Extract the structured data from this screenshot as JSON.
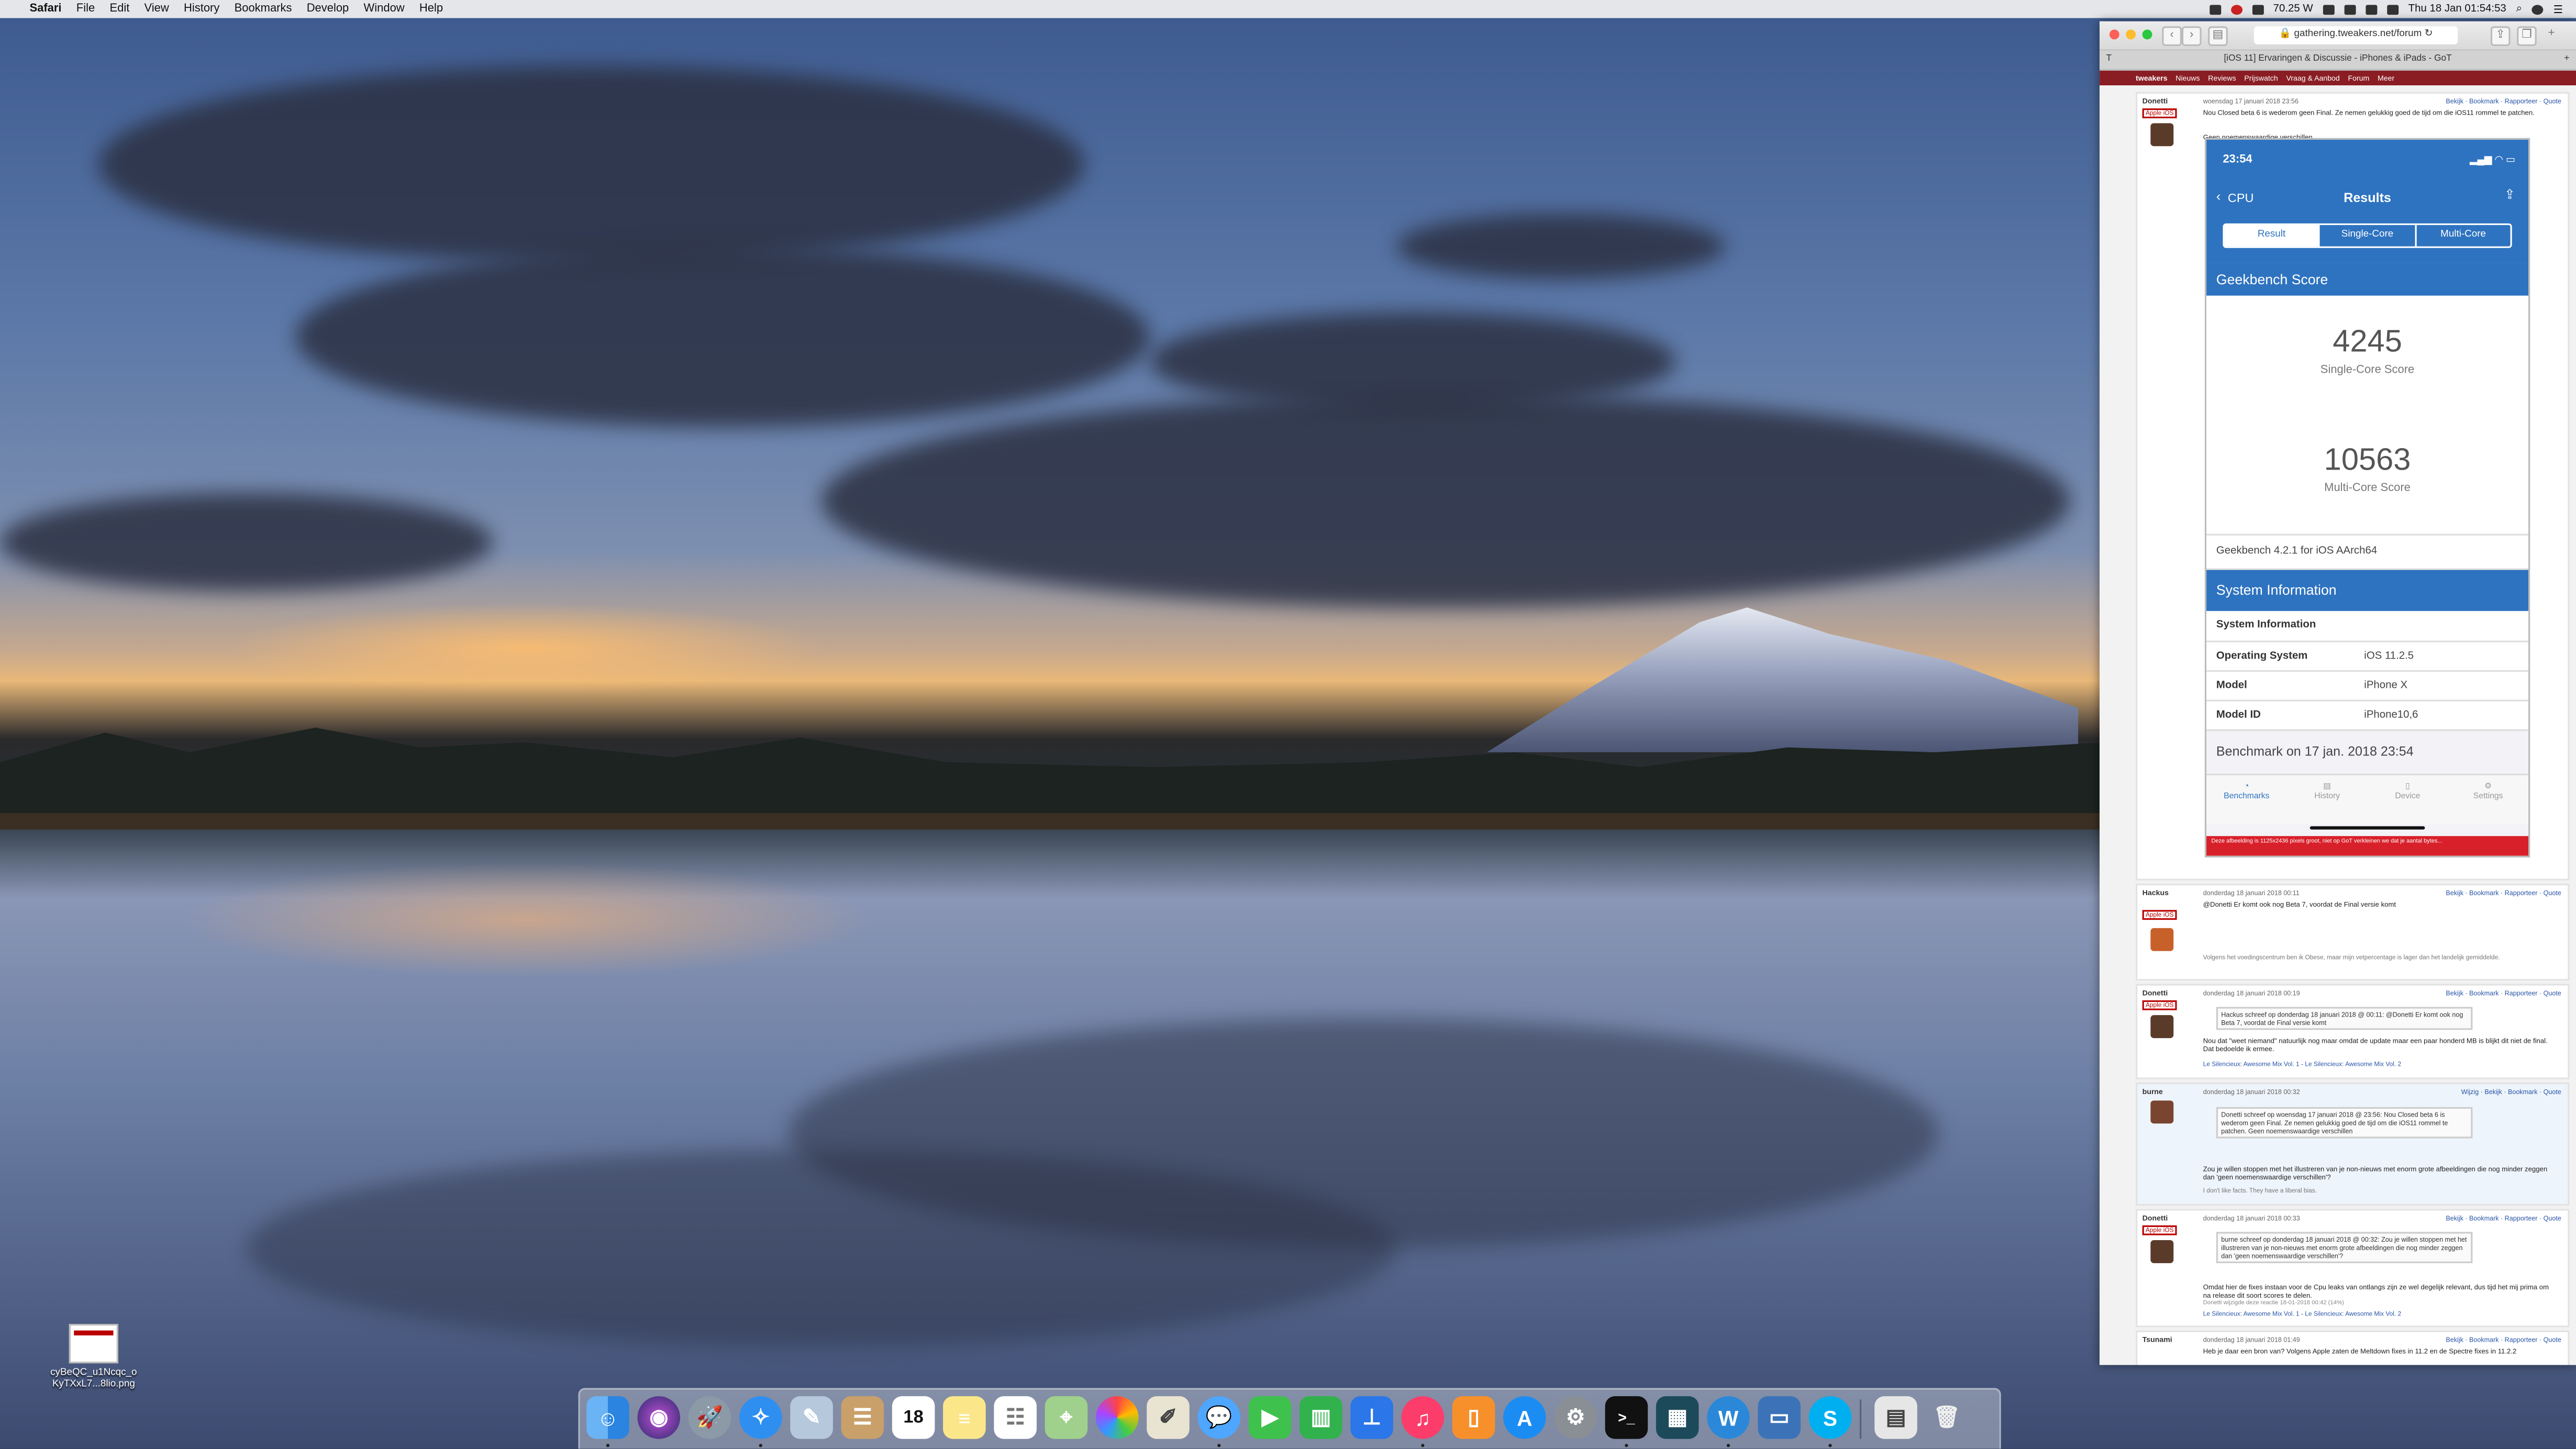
{
  "menubar": {
    "app": "Safari",
    "items": [
      "File",
      "Edit",
      "View",
      "History",
      "Bookmarks",
      "Develop",
      "Window",
      "Help"
    ],
    "power": "70.25 W",
    "datetime": "Thu 18 Jan  01:54:53"
  },
  "desktop": {
    "file_name_line1": "cyBeQC_u1Ncqc_o",
    "file_name_line2": "KyTXxL7...8lio.png"
  },
  "safari": {
    "url": "gathering.tweakers.net/forum",
    "tab_title": "[iOS 11] Ervaringen & Discussie - iPhones & iPads - GoT",
    "site_nav": [
      "Nieuws",
      "Reviews",
      "Prijswatch",
      "Vraag & Aanbod",
      "Forum",
      "Meer"
    ],
    "site_name": "tweakers"
  },
  "posts": [
    {
      "author": "Donetti",
      "badge": "Apple iOS",
      "meta": "woensdag 17 januari 2018 23:56",
      "links": "Bekijk · Bookmark · Rapporteer · Quote",
      "text": "Nou Closed beta 6 is wederom geen Final. Ze nemen gelukkig goed de tijd om die iOS11 rommel te patchen.",
      "text2": "Geen noemenswaardige verschillen"
    },
    {
      "author": "Hackus",
      "badge": "Apple iOS",
      "meta": "donderdag 18 januari 2018 00:11",
      "links": "Bekijk · Bookmark · Rapporteer · Quote",
      "text": "@Donetti Er komt ook nog Beta 7, voordat de Final versie komt",
      "sig": "Volgens het voedingscentrum ben ik Obese, maar mijn vetpercentage is lager dan het landelijk gemiddelde."
    },
    {
      "author": "Donetti",
      "badge": "Apple iOS",
      "meta": "donderdag 18 januari 2018 00:19",
      "links": "Bekijk · Bookmark · Rapporteer · Quote",
      "quote": "Hackus schreef op donderdag 18 januari 2018 @ 00:11: @Donetti Er komt ook nog Beta 7, voordat de Final versie komt",
      "text": "Nou dat \"weet niemand\" natuurlijk nog maar omdat de update maar een paar honderd MB is blijkt dit niet de final. Dat bedoelde ik ermee.",
      "sig": "Le Silencieux: Awesome Mix Vol. 1 - Le Silencieux: Awesome Mix Vol. 2"
    },
    {
      "author": "burne",
      "meta": "donderdag 18 januari 2018 00:32",
      "links": "Wijzig · Bekijk · Bookmark · Quote",
      "quote": "Donetti schreef op woensdag 17 januari 2018 @ 23:56: Nou Closed beta 6 is wederom geen Final. Ze nemen gelukkig goed de tijd om die iOS11 rommel te patchen. Geen noemenswaardige verschillen",
      "text": "Zou je willen stoppen met het illustreren van je non-nieuws met enorm grote afbeeldingen die nog minder zeggen dan 'geen noemenswaardige verschillen'?",
      "sig": "I don't like facts. They have a liberal bias."
    },
    {
      "author": "Donetti",
      "badge": "Apple iOS",
      "meta": "donderdag 18 januari 2018 00:33",
      "links": "Bekijk · Bookmark · Rapporteer · Quote",
      "quote": "burne schreef op donderdag 18 januari 2018 @ 00:32: Zou je willen stoppen met het illustreren van je non-nieuws met enorm grote afbeeldingen die nog minder zeggen dan 'geen noemenswaardige verschillen'?",
      "text": "Omdat hier de fixes instaan voor de Cpu leaks van ontlangs zijn ze wel degelijk relevant, dus tijd het mij prima om na release dit soort scores te delen.",
      "edit": "Donetti wijzigde deze reactie 18-01-2018 00:42 (14%)",
      "sig": "Le Silencieux: Awesome Mix Vol. 1 - Le Silencieux: Awesome Mix Vol. 2"
    },
    {
      "author": "Tsunami",
      "meta": "donderdag 18 januari 2018 01:49",
      "links": "Bekijk · Bookmark · Rapporteer · Quote",
      "text": "Heb je daar een bron van? Volgens Apple zaten de Meltdown fixes in 11.2 en de Spectre fixes in 11.2.2"
    }
  ],
  "geekbench": {
    "status_time": "23:54",
    "back_label": "CPU",
    "title": "Results",
    "segments": [
      "Result",
      "Single-Core",
      "Multi-Core"
    ],
    "score_section": "Geekbench Score",
    "single_score": "4245",
    "single_label": "Single-Core Score",
    "multi_score": "10563",
    "multi_label": "Multi-Core Score",
    "version": "Geekbench 4.2.1 for iOS AArch64",
    "sysinfo_section": "System Information",
    "sysinfo_sub": "System Information",
    "rows": [
      {
        "k": "Operating System",
        "v": "iOS 11.2.5"
      },
      {
        "k": "Model",
        "v": "iPhone X"
      },
      {
        "k": "Model ID",
        "v": "iPhone10,6"
      }
    ],
    "benchmark_date": "Benchmark on 17 jan. 2018 23:54",
    "tabs": [
      "Benchmarks",
      "History",
      "Device",
      "Settings"
    ],
    "warning": "Deze afbeelding is 1125x2436 pixels groot, niet op GoT verkleinen we dat je aantal bytes..."
  },
  "dock": {
    "calendar_day": "18",
    "icons": [
      "finder-icon",
      "siri-icon",
      "launchpad-icon",
      "safari-icon",
      "preview-icon",
      "contacts-icon",
      "calendar-icon",
      "notes-icon",
      "reminders-icon",
      "maps-icon",
      "photos-icon",
      "textedit-icon",
      "messages-icon",
      "facetime-icon",
      "numbers-icon",
      "keynote-icon",
      "itunes-icon",
      "ibooks-icon",
      "appstore-icon",
      "system-preferences-icon",
      "terminal-icon",
      "activity-icon",
      "wunderlist-icon",
      "screen-sharing-icon",
      "skype-icon",
      "downloads-icon",
      "trash-icon"
    ]
  }
}
